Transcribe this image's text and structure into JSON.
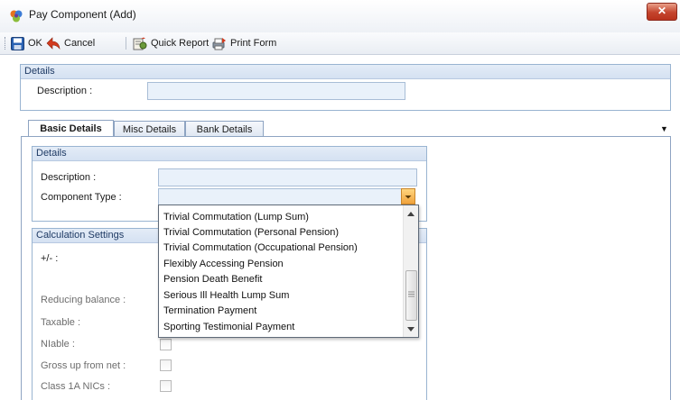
{
  "window": {
    "title": "Pay Component (Add)",
    "close_glyph": "✕",
    "app_icon": "multicolor-app-icon"
  },
  "toolbar": {
    "ok_label": "OK",
    "cancel_label": "Cancel",
    "quick_report_label": "Quick Report",
    "print_form_label": "Print Form"
  },
  "top_details": {
    "header": "Details",
    "description_label": "Description :",
    "description_value": ""
  },
  "tabs": [
    {
      "label": "Basic Details",
      "active": true
    },
    {
      "label": "Misc Details",
      "active": false
    },
    {
      "label": "Bank Details",
      "active": false
    }
  ],
  "tab_overflow_glyph": "▼",
  "basic_details": {
    "header": "Details",
    "description_label": "Description :",
    "description_value": "",
    "component_type_label": "Component Type :",
    "component_type_value": ""
  },
  "calculation_settings": {
    "header": "Calculation Settings",
    "plus_minus_label": "+/- :",
    "reducing_balance_label": "Reducing balance :",
    "taxable_label": "Taxable :",
    "niable_label": "NIable :",
    "gross_up_label": "Gross up from net :",
    "class1a_label": "Class 1A NICs :",
    "niable_checked": false,
    "gross_up_checked": false,
    "class1a_checked": false
  },
  "dropdown": {
    "options": [
      "Trivial Commutation (Lump Sum)",
      "Trivial Commutation (Personal Pension)",
      "Trivial Commutation (Occupational Pension)",
      "Flexibly Accessing Pension",
      "Pension Death Benefit",
      "Serious Ill Health Lump Sum",
      "Termination Payment",
      "Sporting Testimonial Payment"
    ]
  },
  "colors": {
    "group_border": "#99b4d1",
    "field_bg": "#e9f1fa",
    "close_red": "#c4432c",
    "combo_arrow_orange": "#f0a23c"
  }
}
